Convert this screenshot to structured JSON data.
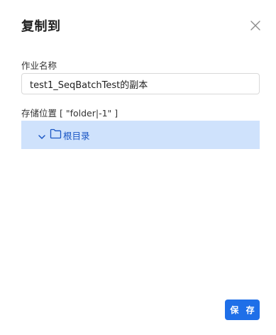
{
  "dialog": {
    "title": "复制到",
    "close_icon": "close-icon"
  },
  "form": {
    "job_name_label": "作业名称",
    "job_name_value": "test1_SeqBatchTest的副本",
    "location_label": "存储位置 [ \"folder|-1\" ]"
  },
  "tree": {
    "root": {
      "label": "根目录",
      "expanded": true,
      "selected": true,
      "icons": [
        "chevron-down-icon",
        "folder-icon"
      ]
    }
  },
  "footer": {
    "save_label": "保 存"
  },
  "colors": {
    "primary": "#1f6fe8",
    "selected_bg": "#cfe2fc",
    "selected_text": "#1a56c4",
    "border": "#d9d9d9"
  }
}
